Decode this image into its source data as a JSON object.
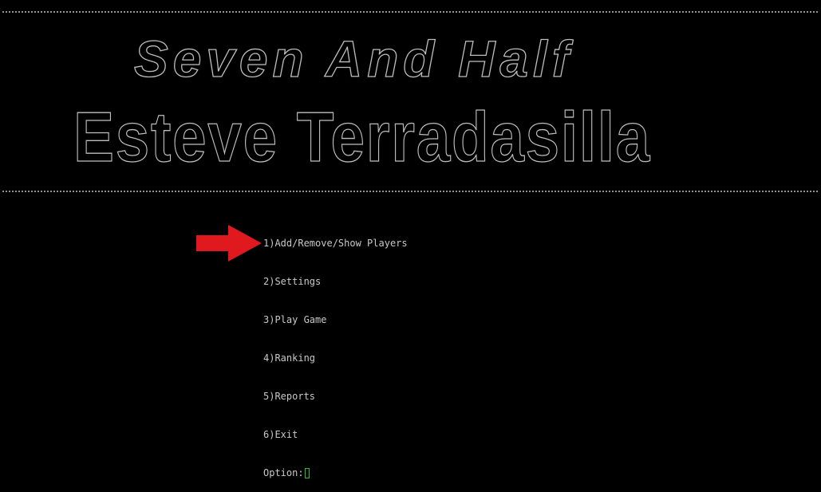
{
  "banner": {
    "title": "Seven And Half",
    "subtitle": "Esteve Terradasilla"
  },
  "menu": {
    "items": [
      "1)Add/Remove/Show Players",
      "2)Settings",
      "3)Play Game",
      "4)Ranking",
      "5)Reports",
      "6)Exit"
    ],
    "prompt": "Option:"
  },
  "colors": {
    "background": "#000000",
    "text": "#c8c8c8",
    "cursor": "#22c22a",
    "arrow": "#e0191e"
  },
  "icons": {
    "pointer": "red-arrow-icon"
  }
}
